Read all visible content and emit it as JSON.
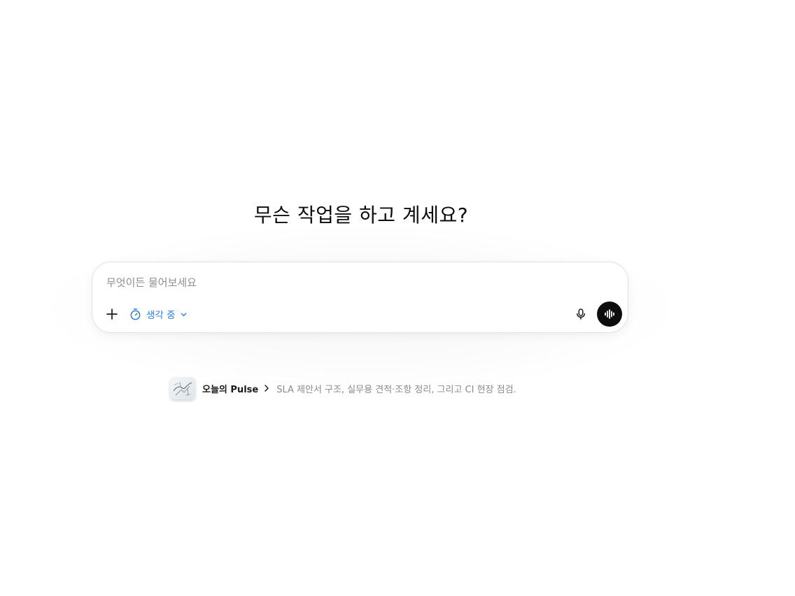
{
  "headline": "무슨 작업을 하고 계세요?",
  "composer": {
    "placeholder": "무엇이든 물어보세요",
    "value": "",
    "think_label": "생각 중",
    "accent_color": "#2f7fd3",
    "icons": {
      "add": "plus-icon",
      "think": "timer-icon",
      "think_dropdown": "chevron-down-icon",
      "mic": "microphone-icon",
      "voice": "voice-waveform-icon"
    }
  },
  "pulse": {
    "title": "오늘의 Pulse",
    "summary": "SLA 제안서 구조, 실무용 견적·조항 정리, 그리고 CI 현장 점검.",
    "icons": {
      "thumbnail": "pulse-thumbnail",
      "open": "chevron-right-icon"
    }
  }
}
